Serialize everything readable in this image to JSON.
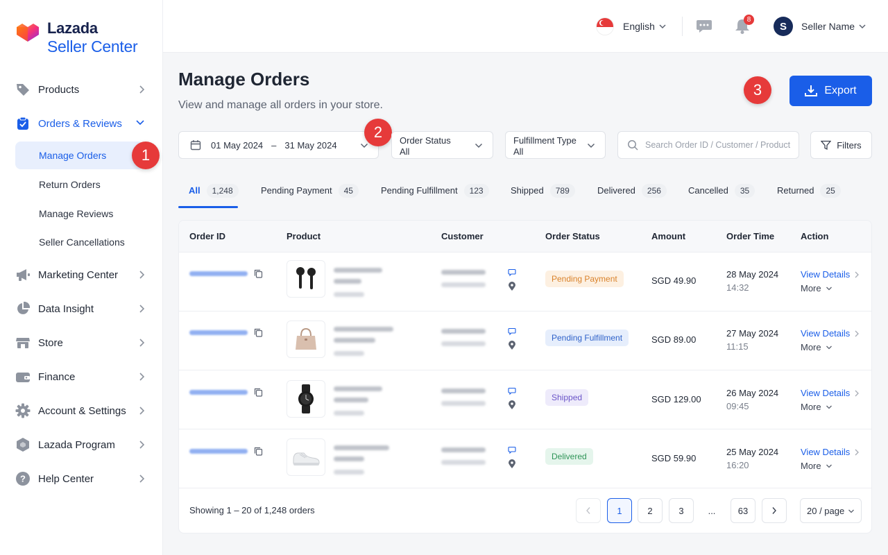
{
  "brand": {
    "line1": "Lazada",
    "line2": "Seller Center"
  },
  "colors": {
    "accent": "#1a5ee8",
    "callout": "#e63a3a"
  },
  "sidebar": {
    "items": [
      {
        "label": "Products",
        "icon": "tag-icon"
      },
      {
        "label": "Orders & Reviews",
        "icon": "clipboard-icon",
        "expanded": true
      },
      {
        "label": "Marketing Center",
        "icon": "megaphone-icon"
      },
      {
        "label": "Data Insight",
        "icon": "pie-chart-icon"
      },
      {
        "label": "Store",
        "icon": "store-icon"
      },
      {
        "label": "Finance",
        "icon": "wallet-icon"
      },
      {
        "label": "Account & Settings",
        "icon": "gear-icon"
      },
      {
        "label": "Lazada Program",
        "icon": "hexagon-icon"
      },
      {
        "label": "Help Center",
        "icon": "help-icon"
      }
    ],
    "subitems": [
      {
        "label": "Manage Orders",
        "active": true
      },
      {
        "label": "Return Orders"
      },
      {
        "label": "Manage Reviews"
      },
      {
        "label": "Seller Cancellations"
      }
    ]
  },
  "callouts": [
    "1",
    "2",
    "3"
  ],
  "header": {
    "language": "English",
    "notification_count": "8",
    "avatar_initial": "S",
    "seller_name": "Seller Name"
  },
  "page": {
    "title": "Manage Orders",
    "subtitle": "View and manage all orders in your store.",
    "export_label": "Export"
  },
  "filters": {
    "date_from": "01 May 2024",
    "date_sep": "–",
    "date_to": "31 May 2024",
    "order_status_label": "Order Status",
    "order_status_value": "All",
    "fulfillment_label": "Fulfillment Type",
    "fulfillment_value": "All",
    "search_placeholder": "Search Order ID / Customer / Product",
    "filters_label": "Filters"
  },
  "tabs": [
    {
      "label": "All",
      "count": "1,248",
      "active": true
    },
    {
      "label": "Pending Payment",
      "count": "45"
    },
    {
      "label": "Pending Fulfillment",
      "count": "123"
    },
    {
      "label": "Shipped",
      "count": "789"
    },
    {
      "label": "Delivered",
      "count": "256"
    },
    {
      "label": "Cancelled",
      "count": "35"
    },
    {
      "label": "Returned",
      "count": "25"
    }
  ],
  "table": {
    "columns": [
      "Order ID",
      "Product",
      "Customer",
      "Order Status",
      "Amount",
      "Order Time",
      "Action"
    ],
    "rows": [
      {
        "status": "Pending Payment",
        "status_bg": "#fdf0e1",
        "status_fg": "#d9822b",
        "amount": "SGD 49.90",
        "date": "28 May 2024",
        "time": "14:32",
        "product_icon": "earbuds-icon"
      },
      {
        "status": "Pending Fulfillment",
        "status_bg": "#e6eefc",
        "status_fg": "#2f62c9",
        "amount": "SGD 89.00",
        "date": "27 May 2024",
        "time": "11:15",
        "product_icon": "handbag-icon"
      },
      {
        "status": "Shipped",
        "status_bg": "#eeebfb",
        "status_fg": "#6b55c8",
        "amount": "SGD 129.00",
        "date": "26 May 2024",
        "time": "09:45",
        "product_icon": "watch-icon"
      },
      {
        "status": "Delivered",
        "status_bg": "#e5f5ec",
        "status_fg": "#2e9457",
        "amount": "SGD 59.90",
        "date": "25 May 2024",
        "time": "16:20",
        "product_icon": "sneaker-icon"
      }
    ],
    "view_details": "View Details",
    "more": "More"
  },
  "pagination": {
    "showing": "Showing 1 – 20 of 1,248 orders",
    "pages": [
      "1",
      "2",
      "3",
      "...",
      "63"
    ],
    "per_page": "20 / page"
  }
}
